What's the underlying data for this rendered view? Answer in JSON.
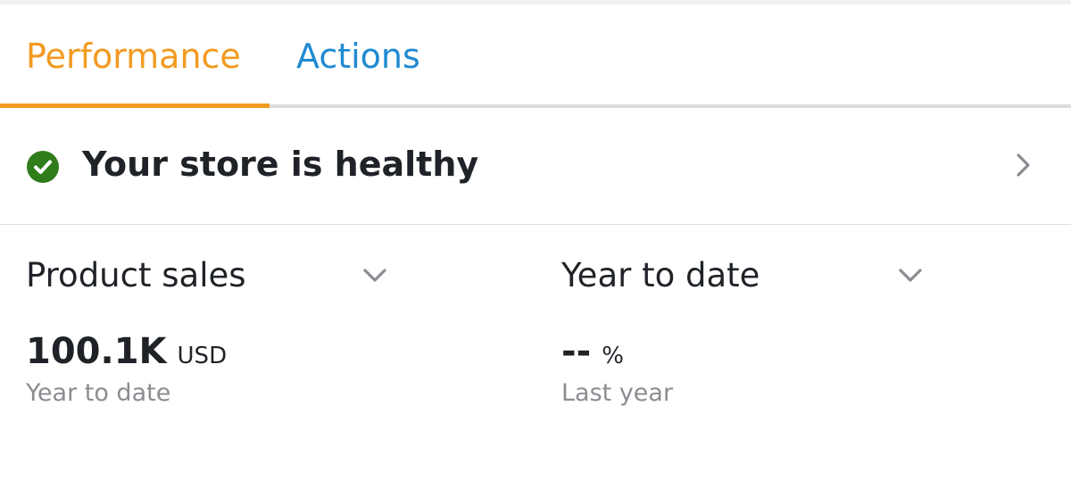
{
  "colors": {
    "active_tab": "#f29a21",
    "link": "#1f8ad2",
    "healthy": "#2e7d1a"
  },
  "tabs": [
    {
      "label": "Performance",
      "state": "active"
    },
    {
      "label": "Actions",
      "state": "inactive"
    }
  ],
  "health": {
    "icon": "check-circle-icon",
    "status_text": "Your store is healthy"
  },
  "metrics": {
    "left": {
      "label": "Product sales",
      "value": "100.1K",
      "unit": "USD",
      "period": "Year to date"
    },
    "right": {
      "label": "Year to date",
      "value": "--",
      "unit": "%",
      "period": "Last year"
    }
  }
}
